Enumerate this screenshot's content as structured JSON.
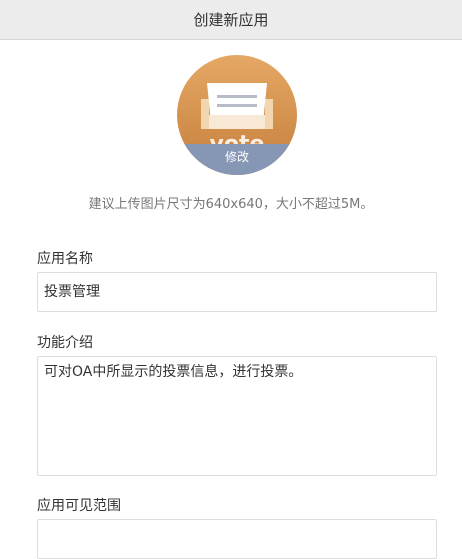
{
  "header": {
    "title": "创建新应用"
  },
  "avatar": {
    "logo_text": "vote",
    "modify_label": "修改",
    "icon": "ballot-box-icon",
    "colors": {
      "background": "#d9964f",
      "overlay": "#8697b6"
    }
  },
  "hint": "建议上传图片尺寸为640x640，大小不超过5M。",
  "form": {
    "name_label": "应用名称",
    "name_value": "投票管理",
    "intro_label": "功能介绍",
    "intro_value": "可对OA中所显示的投票信息，进行投票。",
    "scope_label": "应用可见范围"
  }
}
